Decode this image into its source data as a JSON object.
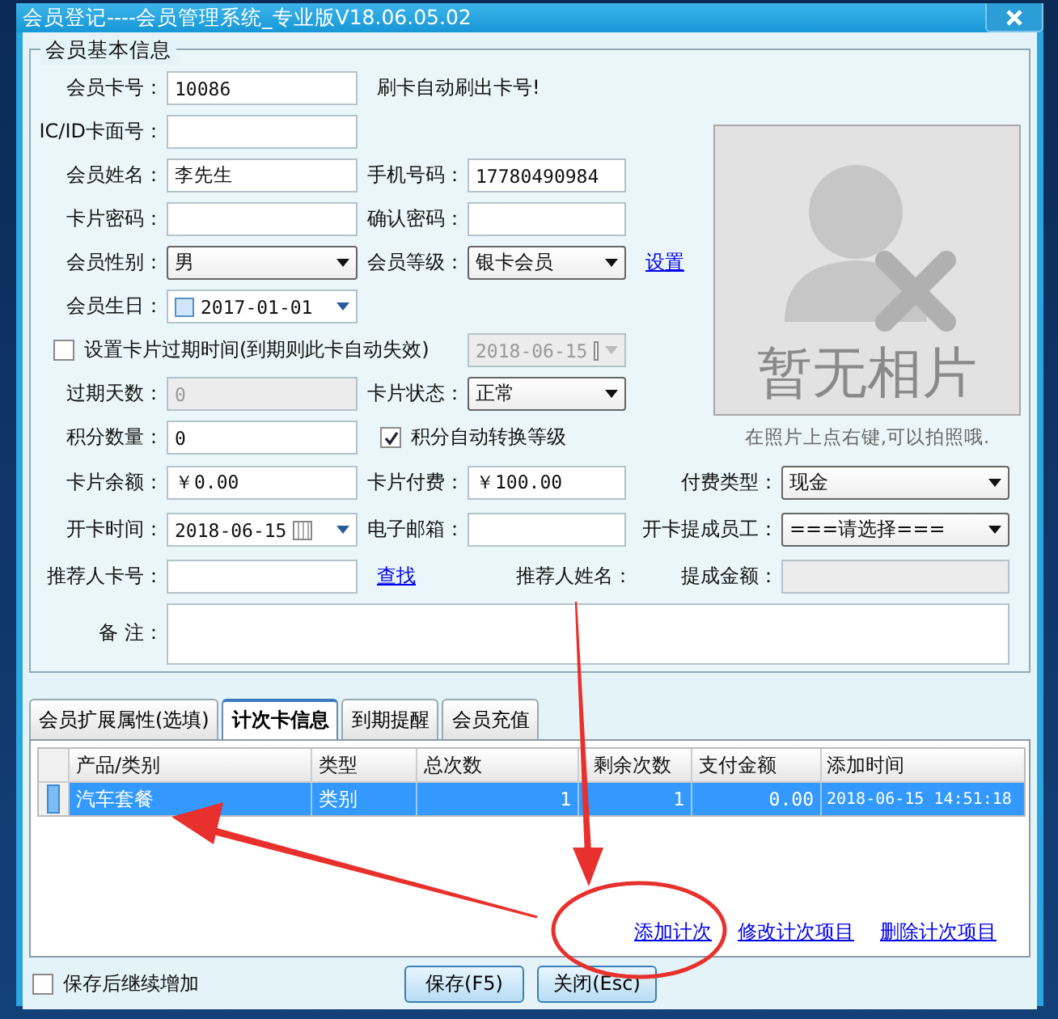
{
  "window": {
    "title": "会员登记----会员管理系统_专业版V18.06.05.02"
  },
  "basic_info": {
    "legend": "会员基本信息",
    "top_rows": [
      [
        {
          "kind": "label",
          "text": "会员卡号："
        },
        {
          "kind": "input",
          "value": "10086",
          "disabled": false
        },
        {
          "kind": "note",
          "text": "刷卡自动刷出卡号!"
        }
      ],
      [
        {
          "kind": "label",
          "text": "IC/ID卡面号："
        },
        {
          "kind": "input",
          "disabled": false
        }
      ],
      [
        {
          "kind": "label",
          "text": "会员姓名："
        },
        {
          "kind": "input",
          "value": "李先生",
          "disabled": false
        },
        {
          "kind": "label",
          "text": "手机号码："
        },
        {
          "kind": "input",
          "value": "17780490984",
          "disabled": false
        }
      ],
      [
        {
          "kind": "label",
          "text": "卡片密码："
        },
        {
          "kind": "input",
          "disabled": false
        },
        {
          "kind": "label",
          "text": "确认密码："
        },
        {
          "kind": "input",
          "disabled": false
        }
      ],
      [
        {
          "kind": "label",
          "text": "会员性别："
        },
        {
          "kind": "select",
          "value": "男",
          "disabled": false
        },
        {
          "kind": "label",
          "text": "会员等级："
        },
        {
          "kind": "select",
          "value": "银卡会员",
          "disabled": false
        },
        {
          "kind": "link",
          "text": "设置"
        }
      ],
      [
        {
          "kind": "label",
          "text": "会员生日："
        },
        {
          "kind": "checkdate",
          "value": "2017-01-01",
          "disabled": false
        }
      ],
      [
        {
          "kind": "checkbox",
          "text": "设置卡片过期时间(到期则此卡自动失效)",
          "checked": false
        },
        {
          "kind": "date",
          "value": "2018-06-15",
          "disabled": true
        }
      ],
      [
        {
          "kind": "label",
          "text": "过期天数："
        },
        {
          "kind": "input",
          "value": "0",
          "disabled": true
        },
        {
          "kind": "label",
          "text": "卡片状态："
        },
        {
          "kind": "select",
          "value": "正常",
          "disabled": false
        }
      ],
      [
        {
          "kind": "label",
          "text": "积分数量："
        },
        {
          "kind": "input",
          "value": "0",
          "disabled": false
        },
        {
          "kind": "checkbox",
          "text": "积分自动转换等级",
          "checked": true
        }
      ]
    ],
    "photo": {
      "text": "暂无相片",
      "caption": "在照片上点右键,可以拍照哦."
    },
    "bottom_rows": [
      [
        {
          "kind": "label",
          "text": "卡片余额："
        },
        {
          "kind": "input",
          "value": "￥0.00",
          "disabled": false
        },
        {
          "kind": "label",
          "text": "卡片付费："
        },
        {
          "kind": "input",
          "value": "￥100.00",
          "disabled": false
        },
        {
          "kind": "label",
          "text": "付费类型："
        },
        {
          "kind": "select",
          "value": "现金",
          "disabled": false
        }
      ],
      [
        {
          "kind": "label",
          "text": "开卡时间："
        },
        {
          "kind": "date",
          "value": "2018-06-15",
          "disabled": false
        },
        {
          "kind": "label",
          "text": "电子邮箱："
        },
        {
          "kind": "input",
          "disabled": false
        },
        {
          "kind": "label",
          "text": "开卡提成员工："
        },
        {
          "kind": "select",
          "value": "===请选择===",
          "disabled": false
        }
      ],
      [
        {
          "kind": "label",
          "text": "推荐人卡号："
        },
        {
          "kind": "input",
          "disabled": false
        },
        {
          "kind": "link",
          "text": "查找"
        },
        {
          "kind": "label",
          "text": "推荐人姓名："
        },
        {
          "kind": "label",
          "text": "提成金额："
        },
        {
          "kind": "input",
          "disabled": true
        }
      ],
      [
        {
          "kind": "label",
          "text": "备 注："
        },
        {
          "kind": "textarea",
          "disabled": false
        }
      ]
    ]
  },
  "tabs": [
    {
      "label": "会员扩展属性(选填)",
      "selected": false
    },
    {
      "label": "计次卡信息",
      "selected": true
    },
    {
      "label": "到期提醒",
      "selected": false
    },
    {
      "label": "会员充值",
      "selected": false
    }
  ],
  "table": {
    "columns": [
      "产品/类别",
      "类型",
      "总次数",
      "剩余次数",
      "支付金额",
      "添加时间"
    ],
    "rows": [
      {
        "cells": [
          "汽车套餐",
          "类别",
          "1",
          "1",
          "0.00",
          "2018-06-15 14:51:18"
        ],
        "selected": true
      }
    ]
  },
  "table_links": [
    "添加计次",
    "修改计次项目",
    "删除计次项目"
  ],
  "footer": {
    "continue_checkbox": {
      "label": "保存后继续增加",
      "checked": false
    },
    "buttons": [
      "保存(F5)",
      "关闭(Esc)"
    ]
  }
}
